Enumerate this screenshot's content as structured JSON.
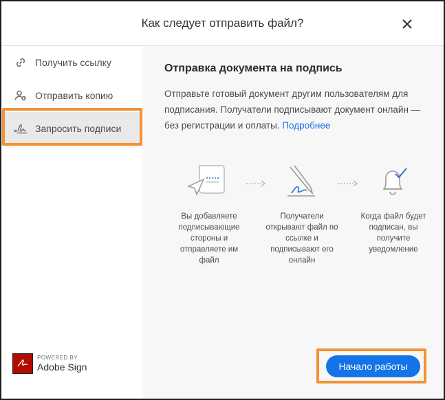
{
  "dialog": {
    "title": "Как следует отправить файл?",
    "close_icon": "close-icon"
  },
  "sidebar": {
    "items": [
      {
        "label": "Получить ссылку",
        "icon": "link-icon",
        "active": false
      },
      {
        "label": "Отправить копию",
        "icon": "add-person-icon",
        "active": false
      },
      {
        "label": "Запросить подписи",
        "icon": "signature-icon",
        "active": true
      }
    ]
  },
  "main": {
    "heading": "Отправка документа на подпись",
    "description": "Отправьте готовый документ другим пользователям для подписания. Получатели подписывают документ онлайн — без регистрации и оплаты.",
    "more_link": "Подробнее",
    "steps": [
      {
        "icon": "send-document-icon",
        "text": "Вы добавляете подписывающие стороны и отправляете им файл"
      },
      {
        "icon": "signing-pen-icon",
        "text": "Получатели открывают файл по ссылке и подписывают его онлайн"
      },
      {
        "icon": "bell-check-icon",
        "text": "Когда файл будет подписан, вы получите уведомление"
      }
    ]
  },
  "footer": {
    "powered_by": "POWERED BY",
    "brand": "Adobe Sign",
    "start_button": "Начало работы"
  },
  "colors": {
    "accent": "#1473e6",
    "highlight": "#f39233",
    "brand_red": "#b30b00"
  }
}
